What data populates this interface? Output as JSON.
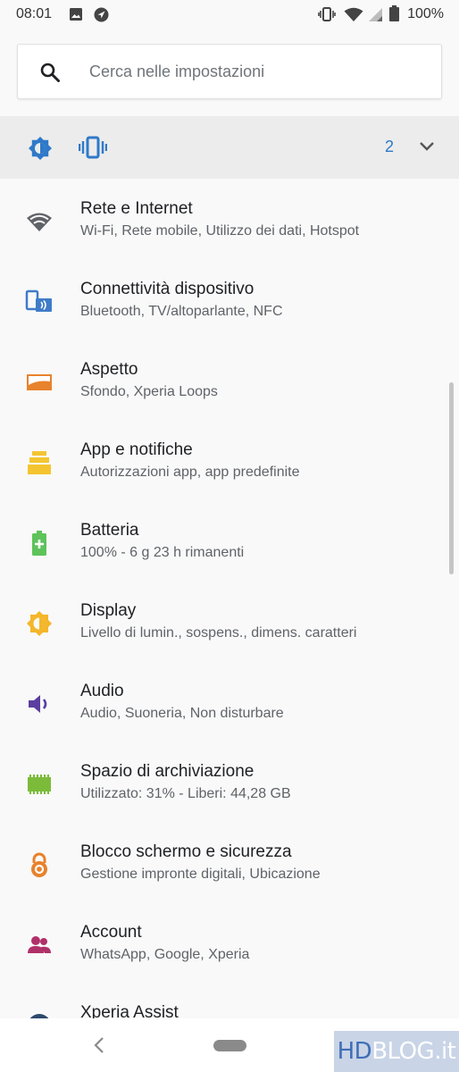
{
  "status_bar": {
    "time": "08:01",
    "battery": "100%"
  },
  "search": {
    "placeholder": "Cerca nelle impostazioni"
  },
  "conditions": {
    "count": "2"
  },
  "settings": [
    {
      "title": "Rete e Internet",
      "subtitle": "Wi-Fi, Rete mobile, Utilizzo dei dati, Hotspot",
      "icon": "wifi-icon",
      "color": "#5f6368"
    },
    {
      "title": "Connettività dispositivo",
      "subtitle": "Bluetooth, TV/altoparlante, NFC",
      "icon": "devices-icon",
      "color": "#3f7cc8"
    },
    {
      "title": "Aspetto",
      "subtitle": "Sfondo, Xperia Loops",
      "icon": "wallpaper-icon",
      "color": "#e8822c"
    },
    {
      "title": "App e notifiche",
      "subtitle": "Autorizzazioni app, app predefinite",
      "icon": "apps-icon",
      "color": "#f4c530"
    },
    {
      "title": "Batteria",
      "subtitle": "100% - 6 g 23 h rimanenti",
      "icon": "battery-icon",
      "color": "#5ec35a"
    },
    {
      "title": "Display",
      "subtitle": "Livello di lumin., sospens., dimens. caratteri",
      "icon": "brightness-icon",
      "color": "#f4b62b"
    },
    {
      "title": "Audio",
      "subtitle": "Audio, Suoneria, Non disturbare",
      "icon": "volume-icon",
      "color": "#5b3fa0"
    },
    {
      "title": "Spazio di archiviazione",
      "subtitle": "Utilizzato: 31% - Liberi: 44,28 GB",
      "icon": "storage-icon",
      "color": "#7cbb3a"
    },
    {
      "title": "Blocco schermo e sicurezza",
      "subtitle": "Gestione impronte digitali, Ubicazione",
      "icon": "lock-icon",
      "color": "#e8822c"
    },
    {
      "title": "Account",
      "subtitle": "WhatsApp, Google, Xperia",
      "icon": "account-icon",
      "color": "#b0316a"
    },
    {
      "title": "Xperia Assist",
      "subtitle": "",
      "icon": "assist-icon",
      "color": "#2e4a6b"
    }
  ],
  "watermark": {
    "part1": "HD",
    "part2": "BLOG.it"
  }
}
